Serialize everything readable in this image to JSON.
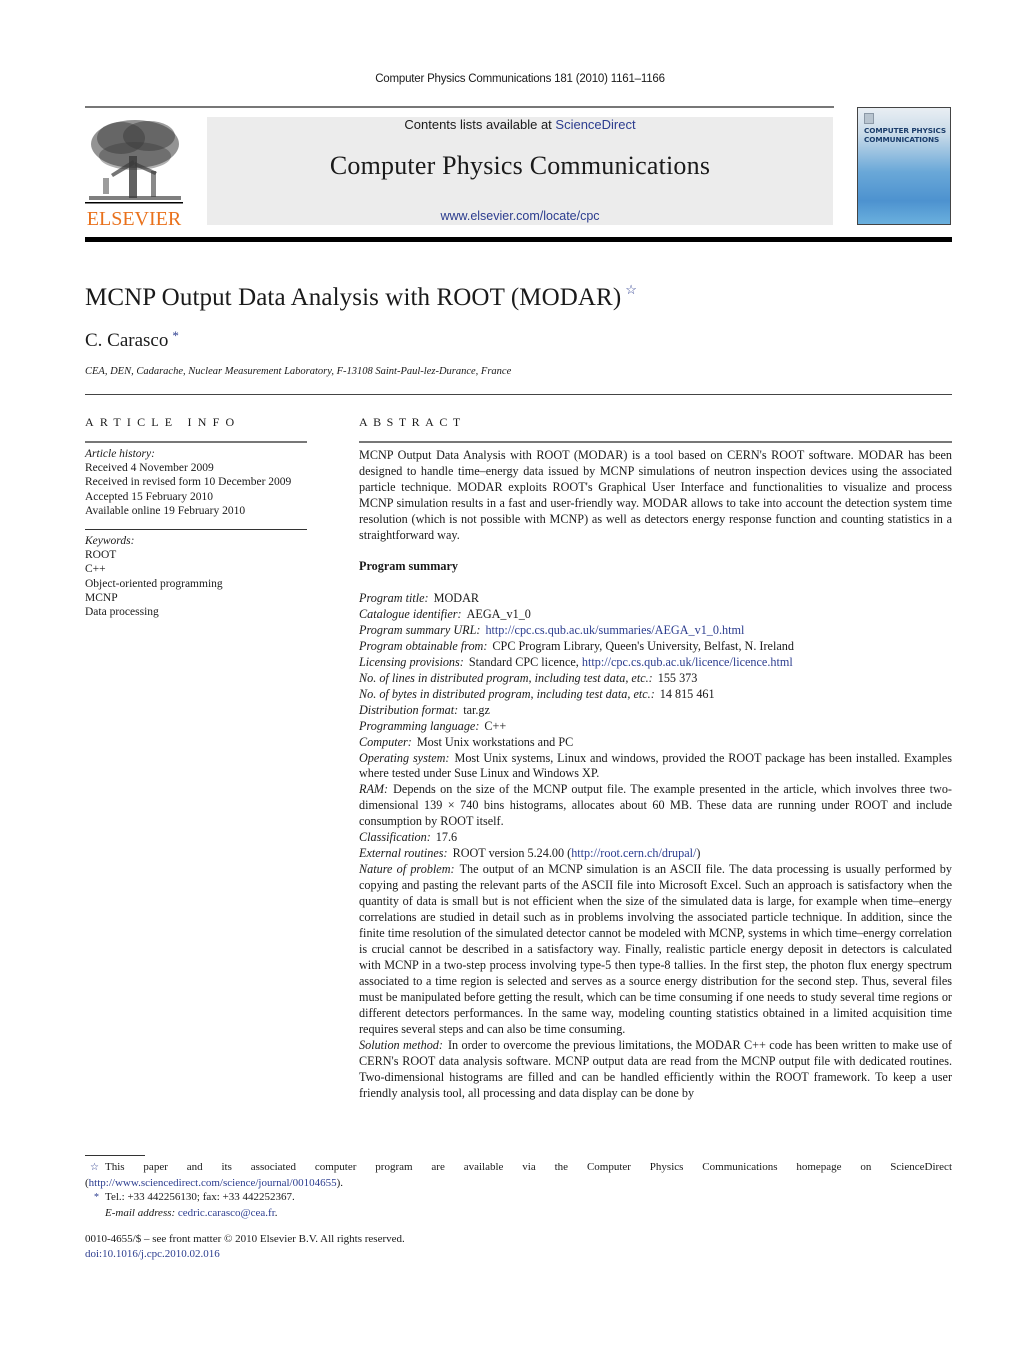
{
  "running_head": "Computer Physics Communications 181 (2010) 1161–1166",
  "masthead": {
    "publisher": "ELSEVIER",
    "contents_prefix": "Contents lists available at ",
    "contents_link": "ScienceDirect",
    "journal_name": "Computer Physics Communications",
    "journal_url": "www.elsevier.com/locate/cpc",
    "cover_title_line1": "COMPUTER PHYSICS",
    "cover_title_line2": "COMMUNICATIONS"
  },
  "article": {
    "title": "MCNP Output Data Analysis with ROOT (MODAR)",
    "title_mark": "☆",
    "author": "C. Carasco",
    "author_mark": "*",
    "affiliation": "CEA, DEN, Cadarache, Nuclear Measurement Laboratory, F-13108 Saint-Paul-lez-Durance, France"
  },
  "article_info": {
    "heading": "ARTICLE INFO",
    "history_label": "Article history:",
    "history": [
      "Received 4 November 2009",
      "Received in revised form 10 December 2009",
      "Accepted 15 February 2010",
      "Available online 19 February 2010"
    ],
    "keywords_label": "Keywords:",
    "keywords": [
      "ROOT",
      "C++",
      "Object-oriented programming",
      "MCNP",
      "Data processing"
    ]
  },
  "abstract": {
    "heading": "ABSTRACT",
    "text": "MCNP Output Data Analysis with ROOT (MODAR) is a tool based on CERN's ROOT software. MODAR has been designed to handle time–energy data issued by MCNP simulations of neutron inspection devices using the associated particle technique. MODAR exploits ROOT's Graphical User Interface and functionalities to visualize and process MCNP simulation results in a fast and user-friendly way. MODAR allows to take into account the detection system time resolution (which is not possible with MCNP) as well as detectors energy response function and counting statistics in a straightforward way."
  },
  "program_summary": {
    "heading": "Program summary",
    "items": [
      {
        "label": "Program title:",
        "value": "MODAR"
      },
      {
        "label": "Catalogue identifier:",
        "value": "AEGA_v1_0"
      },
      {
        "label": "Program summary URL:",
        "value": "",
        "link": "http://cpc.cs.qub.ac.uk/summaries/AEGA_v1_0.html"
      },
      {
        "label": "Program obtainable from:",
        "value": "CPC Program Library, Queen's University, Belfast, N. Ireland"
      },
      {
        "label": "Licensing provisions:",
        "value": "Standard CPC licence, ",
        "link": "http://cpc.cs.qub.ac.uk/licence/licence.html"
      },
      {
        "label": "No. of lines in distributed program, including test data, etc.:",
        "value": "155 373"
      },
      {
        "label": "No. of bytes in distributed program, including test data, etc.:",
        "value": "14 815 461"
      },
      {
        "label": "Distribution format:",
        "value": "tar.gz"
      },
      {
        "label": "Programming language:",
        "value": "C++"
      },
      {
        "label": "Computer:",
        "value": "Most Unix workstations and PC"
      },
      {
        "label": "Operating system:",
        "value": "Most Unix systems, Linux and windows, provided the ROOT package has been installed. Examples where tested under Suse Linux and Windows XP."
      },
      {
        "label": "RAM:",
        "value": "Depends on the size of the MCNP output file. The example presented in the article, which involves three two-dimensional 139 × 740 bins histograms, allocates about 60 MB. These data are running under ROOT and include consumption by ROOT itself."
      },
      {
        "label": "Classification:",
        "value": "17.6"
      },
      {
        "label": "External routines:",
        "value": "ROOT version 5.24.00 (",
        "link": "http://root.cern.ch/drupal/",
        "suffix": ")"
      },
      {
        "label": "Nature of problem:",
        "value": "The output of an MCNP simulation is an ASCII file. The data processing is usually performed by copying and pasting the relevant parts of the ASCII file into Microsoft Excel. Such an approach is satisfactory when the quantity of data is small but is not efficient when the size of the simulated data is large, for example when time–energy correlations are studied in detail such as in problems involving the associated particle technique. In addition, since the finite time resolution of the simulated detector cannot be modeled with MCNP, systems in which time–energy correlation is crucial cannot be described in a satisfactory way. Finally, realistic particle energy deposit in detectors is calculated with MCNP in a two-step process involving type-5 then type-8 tallies. In the first step, the photon flux energy spectrum associated to a time region is selected and serves as a source energy distribution for the second step. Thus, several files must be manipulated before getting the result, which can be time consuming if one needs to study several time regions or different detectors performances. In the same way, modeling counting statistics obtained in a limited acquisition time requires several steps and can also be time consuming."
      },
      {
        "label": "Solution method:",
        "value": "In order to overcome the previous limitations, the MODAR C++ code has been written to make use of CERN's ROOT data analysis software. MCNP output data are read from the MCNP output file with dedicated routines. Two-dimensional histograms are filled and can be handled efficiently within the ROOT framework. To keep a user friendly analysis tool, all processing and data display can be done by"
      }
    ]
  },
  "footnotes": {
    "star_mark": "☆",
    "star_text": "This paper and its associated computer program are available via the Computer Physics Communications homepage on ScienceDirect (",
    "star_link": "http://www.sciencedirect.com/science/journal/00104655",
    "star_suffix": ").",
    "author_mark": "*",
    "author_text": "Tel.: +33 442256130; fax: +33 442252367.",
    "email_label": "E-mail address:",
    "email": "cedric.carasco@cea.fr",
    "email_suffix": "."
  },
  "bottom": {
    "issn_line": "0010-4655/$ – see front matter  © 2010 Elsevier B.V. All rights reserved.",
    "doi": "doi:10.1016/j.cpc.2010.02.016"
  },
  "colors": {
    "link": "#2c3d8f",
    "elsevier_orange": "#e9711c",
    "masthead_gray": "#ececec"
  }
}
